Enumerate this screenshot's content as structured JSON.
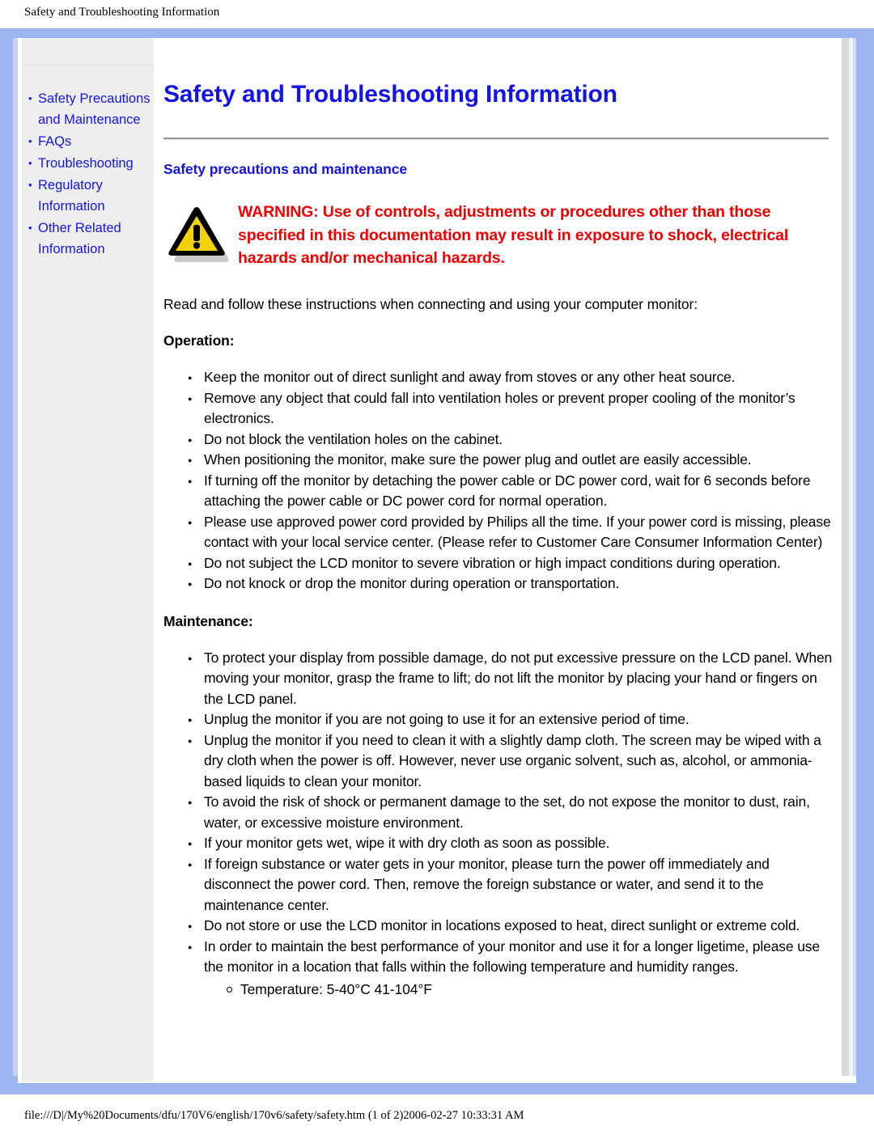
{
  "print_header": "Safety and Troubleshooting Information",
  "print_footer": "file:///D|/My%20Documents/dfu/170V6/english/170v6/safety/safety.htm (1 of 2)2006-02-27 10:33:31 AM",
  "colors": {
    "frame_blue": "#9db4f2",
    "link_blue": "#1414e6",
    "warning_red": "#f40000",
    "sidebar_gray": "#eeeeee",
    "icon_yellow": "#f2d202",
    "icon_outline": "#000000"
  },
  "sidebar": {
    "items": [
      {
        "label": "Safety Precautions and Maintenance"
      },
      {
        "label": "FAQs"
      },
      {
        "label": "Troubleshooting"
      },
      {
        "label": "Regulatory Information"
      },
      {
        "label": "Other Related Information"
      }
    ]
  },
  "main": {
    "title": "Safety and Troubleshooting Information",
    "section_title": "Safety precautions and maintenance",
    "warning_icon_name": "warning-triangle-icon",
    "warning_text": "WARNING: Use of controls, adjustments or procedures other than those specified in this documentation may result in exposure to shock, electrical hazards and/or mechanical hazards.",
    "intro": "Read and follow these instructions when connecting and using your computer monitor:",
    "operation_heading": "Operation:",
    "operation_items": [
      "Keep the monitor out of direct sunlight and away from stoves or any other heat source.",
      "Remove any object that could fall into ventilation holes or prevent proper cooling of the monitor’s electronics.",
      "Do not block the ventilation holes on the cabinet.",
      "When positioning the monitor, make sure the power plug and outlet are easily accessible.",
      "If turning off the monitor by detaching the power cable or DC power cord, wait for 6 seconds before attaching the power cable or DC power cord for normal operation.",
      "Please use approved power cord provided by Philips all the time. If your power cord is missing, please contact with your local service center. (Please refer to Customer Care Consumer Information Center)",
      "Do not subject the LCD monitor to severe vibration or high impact conditions during operation.",
      "Do not knock or drop the monitor during operation or transportation."
    ],
    "maintenance_heading": "Maintenance:",
    "maintenance_items": [
      "To protect your display from possible damage, do not put excessive pressure on the LCD panel. When moving your monitor, grasp the frame to lift; do not lift the monitor by placing your hand or fingers on the LCD panel.",
      "Unplug the monitor if you are not going to use it for an extensive period of time.",
      "Unplug the monitor if you need to clean it with a slightly damp cloth. The screen may be wiped with a dry cloth when the power is off. However, never use organic solvent, such as, alcohol, or ammonia-based liquids to clean your monitor.",
      "To avoid the risk of shock or permanent damage to the set, do not expose the monitor to dust, rain, water, or excessive moisture environment.",
      "If your monitor gets wet, wipe it with dry cloth as soon as possible.",
      "If foreign substance or water gets in your monitor, please turn the power off immediately and disconnect the power cord. Then, remove the foreign substance or water, and send it to the maintenance center.",
      "Do not store or use the LCD monitor in locations exposed to heat, direct sunlight or extreme cold.",
      "In order to maintain the best performance of your monitor and use it for a longer ligetime, please use the monitor in a location that falls within the following temperature and humidity ranges."
    ],
    "maintenance_subitems": [
      "Temperature: 5-40°C 41-104°F"
    ]
  }
}
